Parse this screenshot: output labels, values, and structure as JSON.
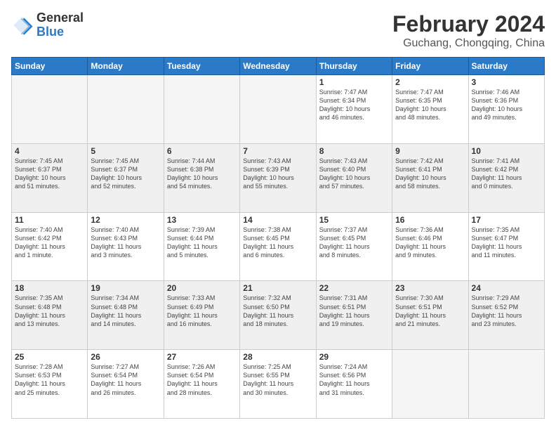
{
  "logo": {
    "general": "General",
    "blue": "Blue"
  },
  "title": "February 2024",
  "subtitle": "Guchang, Chongqing, China",
  "weekdays": [
    "Sunday",
    "Monday",
    "Tuesday",
    "Wednesday",
    "Thursday",
    "Friday",
    "Saturday"
  ],
  "weeks": [
    [
      {
        "day": "",
        "info": ""
      },
      {
        "day": "",
        "info": ""
      },
      {
        "day": "",
        "info": ""
      },
      {
        "day": "",
        "info": ""
      },
      {
        "day": "1",
        "info": "Sunrise: 7:47 AM\nSunset: 6:34 PM\nDaylight: 10 hours\nand 46 minutes."
      },
      {
        "day": "2",
        "info": "Sunrise: 7:47 AM\nSunset: 6:35 PM\nDaylight: 10 hours\nand 48 minutes."
      },
      {
        "day": "3",
        "info": "Sunrise: 7:46 AM\nSunset: 6:36 PM\nDaylight: 10 hours\nand 49 minutes."
      }
    ],
    [
      {
        "day": "4",
        "info": "Sunrise: 7:45 AM\nSunset: 6:37 PM\nDaylight: 10 hours\nand 51 minutes."
      },
      {
        "day": "5",
        "info": "Sunrise: 7:45 AM\nSunset: 6:37 PM\nDaylight: 10 hours\nand 52 minutes."
      },
      {
        "day": "6",
        "info": "Sunrise: 7:44 AM\nSunset: 6:38 PM\nDaylight: 10 hours\nand 54 minutes."
      },
      {
        "day": "7",
        "info": "Sunrise: 7:43 AM\nSunset: 6:39 PM\nDaylight: 10 hours\nand 55 minutes."
      },
      {
        "day": "8",
        "info": "Sunrise: 7:43 AM\nSunset: 6:40 PM\nDaylight: 10 hours\nand 57 minutes."
      },
      {
        "day": "9",
        "info": "Sunrise: 7:42 AM\nSunset: 6:41 PM\nDaylight: 10 hours\nand 58 minutes."
      },
      {
        "day": "10",
        "info": "Sunrise: 7:41 AM\nSunset: 6:42 PM\nDaylight: 11 hours\nand 0 minutes."
      }
    ],
    [
      {
        "day": "11",
        "info": "Sunrise: 7:40 AM\nSunset: 6:42 PM\nDaylight: 11 hours\nand 1 minute."
      },
      {
        "day": "12",
        "info": "Sunrise: 7:40 AM\nSunset: 6:43 PM\nDaylight: 11 hours\nand 3 minutes."
      },
      {
        "day": "13",
        "info": "Sunrise: 7:39 AM\nSunset: 6:44 PM\nDaylight: 11 hours\nand 5 minutes."
      },
      {
        "day": "14",
        "info": "Sunrise: 7:38 AM\nSunset: 6:45 PM\nDaylight: 11 hours\nand 6 minutes."
      },
      {
        "day": "15",
        "info": "Sunrise: 7:37 AM\nSunset: 6:45 PM\nDaylight: 11 hours\nand 8 minutes."
      },
      {
        "day": "16",
        "info": "Sunrise: 7:36 AM\nSunset: 6:46 PM\nDaylight: 11 hours\nand 9 minutes."
      },
      {
        "day": "17",
        "info": "Sunrise: 7:35 AM\nSunset: 6:47 PM\nDaylight: 11 hours\nand 11 minutes."
      }
    ],
    [
      {
        "day": "18",
        "info": "Sunrise: 7:35 AM\nSunset: 6:48 PM\nDaylight: 11 hours\nand 13 minutes."
      },
      {
        "day": "19",
        "info": "Sunrise: 7:34 AM\nSunset: 6:48 PM\nDaylight: 11 hours\nand 14 minutes."
      },
      {
        "day": "20",
        "info": "Sunrise: 7:33 AM\nSunset: 6:49 PM\nDaylight: 11 hours\nand 16 minutes."
      },
      {
        "day": "21",
        "info": "Sunrise: 7:32 AM\nSunset: 6:50 PM\nDaylight: 11 hours\nand 18 minutes."
      },
      {
        "day": "22",
        "info": "Sunrise: 7:31 AM\nSunset: 6:51 PM\nDaylight: 11 hours\nand 19 minutes."
      },
      {
        "day": "23",
        "info": "Sunrise: 7:30 AM\nSunset: 6:51 PM\nDaylight: 11 hours\nand 21 minutes."
      },
      {
        "day": "24",
        "info": "Sunrise: 7:29 AM\nSunset: 6:52 PM\nDaylight: 11 hours\nand 23 minutes."
      }
    ],
    [
      {
        "day": "25",
        "info": "Sunrise: 7:28 AM\nSunset: 6:53 PM\nDaylight: 11 hours\nand 25 minutes."
      },
      {
        "day": "26",
        "info": "Sunrise: 7:27 AM\nSunset: 6:54 PM\nDaylight: 11 hours\nand 26 minutes."
      },
      {
        "day": "27",
        "info": "Sunrise: 7:26 AM\nSunset: 6:54 PM\nDaylight: 11 hours\nand 28 minutes."
      },
      {
        "day": "28",
        "info": "Sunrise: 7:25 AM\nSunset: 6:55 PM\nDaylight: 11 hours\nand 30 minutes."
      },
      {
        "day": "29",
        "info": "Sunrise: 7:24 AM\nSunset: 6:56 PM\nDaylight: 11 hours\nand 31 minutes."
      },
      {
        "day": "",
        "info": ""
      },
      {
        "day": "",
        "info": ""
      }
    ]
  ]
}
